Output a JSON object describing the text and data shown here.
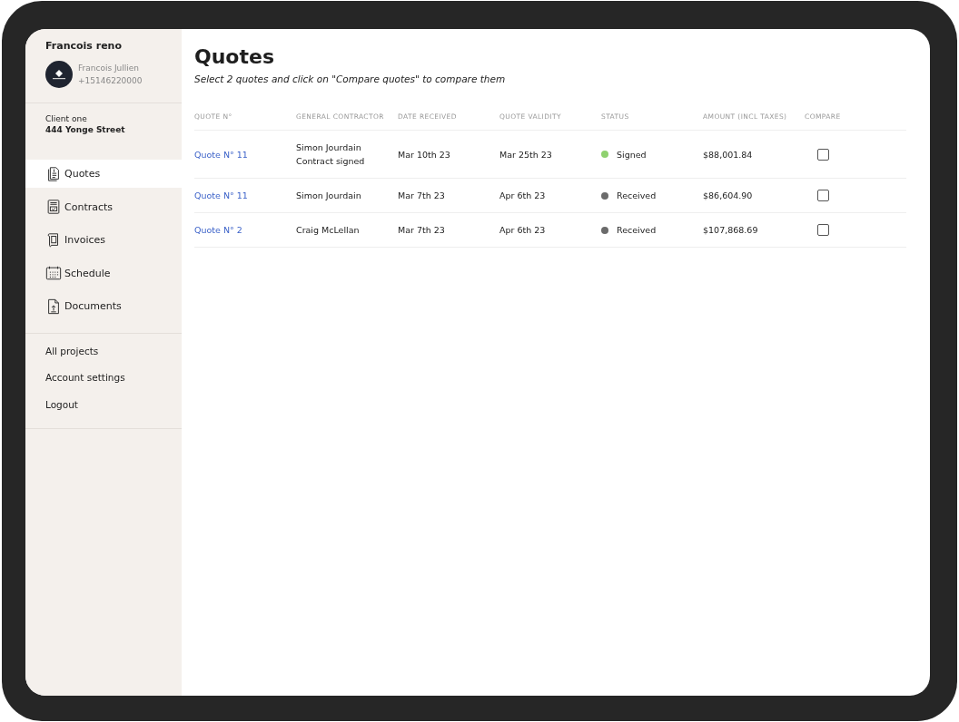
{
  "sidebar": {
    "company": "Francois reno",
    "user": {
      "name": "Francois Jullien",
      "phone": "+15146220000"
    },
    "client": {
      "label": "Client one",
      "address": "444 Yonge Street"
    },
    "nav": [
      {
        "label": "Quotes",
        "kind": "quotes",
        "selected": true
      },
      {
        "label": "Contracts",
        "kind": "contracts",
        "selected": false
      },
      {
        "label": "Invoices",
        "kind": "invoices",
        "selected": false
      },
      {
        "label": "Schedule",
        "kind": "schedule",
        "selected": false
      },
      {
        "label": "Documents",
        "kind": "documents",
        "selected": false
      }
    ],
    "links": [
      "All projects",
      "Account settings",
      "Logout"
    ]
  },
  "main": {
    "title": "Quotes",
    "subtitle": "Select 2 quotes and click on \"Compare quotes\" to compare them",
    "table": {
      "columns": [
        "QUOTE N°",
        "GENERAL CONTRACTOR",
        "DATE RECEIVED",
        "QUOTE VALIDITY",
        "STATUS",
        "AMOUNT (INCL TAXES)",
        "COMPARE"
      ],
      "rows": [
        {
          "quote": "Quote N° 11",
          "contractor": [
            "Simon Jourdain",
            "Contract signed"
          ],
          "received": "Mar 10th 23",
          "validity": "Mar 25th 23",
          "status": "Signed",
          "color": "#8fd16f",
          "amount": "$88,001.84",
          "checked": false
        },
        {
          "quote": "Quote N° 11",
          "contractor": [
            "Simon Jourdain"
          ],
          "received": "Mar 7th 23",
          "validity": "Apr 6th 23",
          "status": "Received",
          "color": "#6b6b6b",
          "amount": "$86,604.90",
          "checked": false
        },
        {
          "quote": "Quote N° 2",
          "contractor": [
            "Craig McLellan"
          ],
          "received": "Mar 7th 23",
          "validity": "Apr 6th 23",
          "status": "Received",
          "color": "#6b6b6b",
          "amount": "$107,868.69",
          "checked": false
        }
      ]
    }
  }
}
